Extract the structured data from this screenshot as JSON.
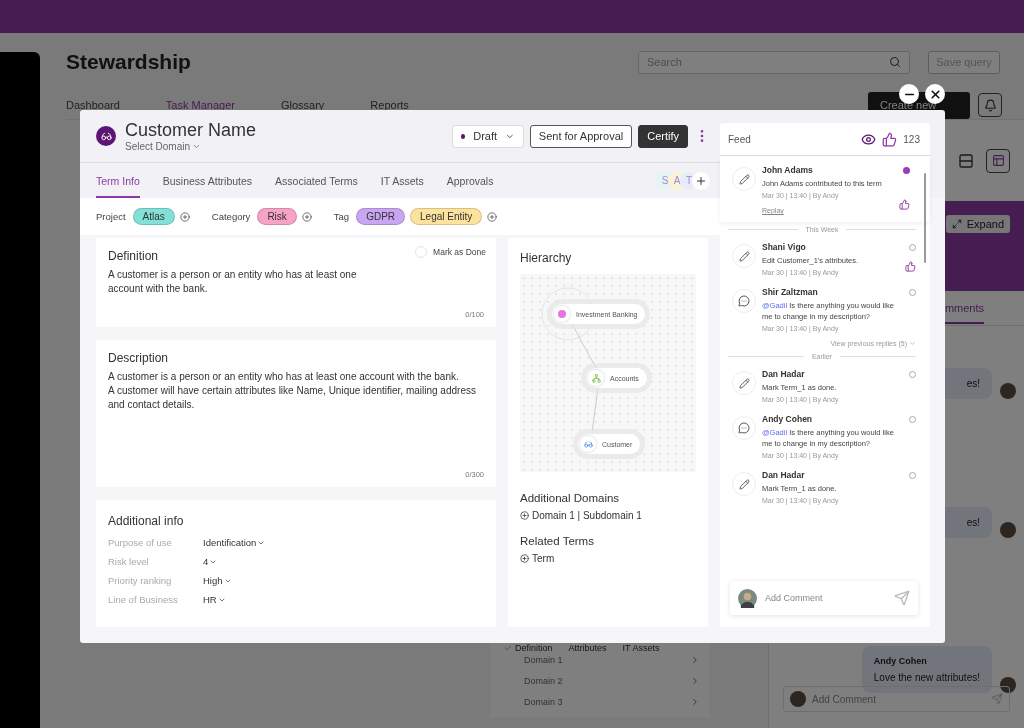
{
  "page": {
    "title": "Stewardship",
    "search": {
      "placeholder": "Search"
    },
    "save_query": "Save query",
    "tabs": [
      {
        "label": "Dashboard",
        "selected": false
      },
      {
        "label": "Task Manager",
        "selected": true
      },
      {
        "label": "Glossary",
        "selected": false
      },
      {
        "label": "Reports",
        "selected": false
      }
    ],
    "create_button": "Create new",
    "domain_panel": {
      "tabs": [
        {
          "label": "Definition",
          "done": true
        },
        {
          "label": "Attributes",
          "done": false
        },
        {
          "label": "IT Assets",
          "done": false
        }
      ],
      "rows": [
        "Domain 1",
        "Domain 2",
        "Domain 3"
      ]
    },
    "detail_panel": {
      "expand": "Expand",
      "tab": "mments",
      "messages": [
        {
          "text": "es!"
        },
        {
          "text": "es!"
        },
        {
          "author": "Andy Cohen",
          "text": "Love the new attributes!"
        }
      ],
      "comment": {
        "placeholder": "Add Comment"
      }
    }
  },
  "modal": {
    "title": "Customer Name",
    "domain": "Select Domain",
    "status": "Draft",
    "actions": [
      {
        "label": "Sent for Approval",
        "kind": "outline"
      },
      {
        "label": "Certify",
        "kind": "solid"
      }
    ],
    "tabs": [
      {
        "label": "Term Info",
        "selected": true
      },
      {
        "label": "Business Attributes",
        "selected": false
      },
      {
        "label": "Associated Terms",
        "selected": false
      },
      {
        "label": "IT Assets",
        "selected": false
      },
      {
        "label": "Approvals",
        "selected": false
      }
    ],
    "collaborators": [
      {
        "initial": "S",
        "color": "#e3f6f4"
      },
      {
        "initial": "A",
        "color": "#fbf3d6"
      },
      {
        "initial": "T",
        "color": "#e6ecfa"
      }
    ],
    "properties": [
      {
        "label": "Project",
        "tags": [
          {
            "text": "Atlas",
            "color": "#82e0d6"
          }
        ]
      },
      {
        "label": "Category",
        "tags": [
          {
            "text": "Risk",
            "color": "#f7a3c6"
          }
        ]
      },
      {
        "label": "Tag",
        "tags": [
          {
            "text": "GDPR",
            "color": "#c9a6f2"
          },
          {
            "text": "Legal Entity",
            "color": "#fce39d"
          }
        ]
      }
    ],
    "definition": {
      "title": "Definition",
      "text": "A customer is a person or an entity who has at least one account with the bank.",
      "counter": "0/100",
      "mark_done": {
        "label": "Mark as Done",
        "checked": false
      }
    },
    "description": {
      "title": "Description",
      "paragraphs": [
        "A customer is a person or an entity who has at least one account with the bank.",
        "A customer will have certain attributes like Name, Unique identifier, mailing address and contact details."
      ],
      "counter": "0/300"
    },
    "additional_info": {
      "title": "Additional info",
      "fields": [
        {
          "label": "Purpose of use",
          "value": "Identification"
        },
        {
          "label": "Risk level",
          "value": "4"
        },
        {
          "label": "Priority ranking",
          "value": "High"
        },
        {
          "label": "Line of Business",
          "value": "HR"
        }
      ]
    },
    "hierarchy": {
      "title": "Hierarchy",
      "nodes": [
        {
          "label": "Investment Banking",
          "kind": "domain"
        },
        {
          "label": "Accounts",
          "kind": "group"
        },
        {
          "label": "Customer",
          "kind": "term"
        }
      ]
    },
    "additional_domains": {
      "title": "Additional Domains",
      "items": [
        "Domain 1 | Subdomain 1"
      ]
    },
    "related_terms": {
      "title": "Related Terms",
      "items": [
        "Term"
      ]
    },
    "feed": {
      "title": "Feed",
      "likes": "123",
      "entries": [
        {
          "kind": "activity",
          "author": "John Adams",
          "text": "John Adams contributed to this term",
          "meta": "Mar 30 | 13:40 | By Andy",
          "unread": true,
          "liked": true,
          "reply": "Replay"
        },
        {
          "kind": "divider",
          "label": "This Week"
        },
        {
          "kind": "activity",
          "author": "Shani Vigo",
          "text": "Edit Customer_1's attributes.",
          "meta": "Mar 30 | 13:40 | By Andy",
          "unread": false,
          "liked": true
        },
        {
          "kind": "comment",
          "author": "Shir Zaltzman",
          "mention": "@Gadil",
          "text": "Is there anything you would like me to change in my description?",
          "meta": "Mar 30 | 13:40 | By Andy",
          "unread": false,
          "liked": false
        },
        {
          "kind": "more",
          "label": "View previous replies (5)"
        },
        {
          "kind": "divider",
          "label": "Earlier"
        },
        {
          "kind": "activity",
          "author": "Dan Hadar",
          "text": "Mark Term_1 as done.",
          "meta": "Mar 30 | 13:40 | By Andy",
          "unread": false,
          "liked": false
        },
        {
          "kind": "comment",
          "author": "Andy Cohen",
          "mention": "@Gadil",
          "text": "Is there anything you would like me to change in my description?",
          "meta": "Mar 30 | 13:40 | By Andy",
          "unread": false,
          "liked": false
        },
        {
          "kind": "activity",
          "author": "Dan Hadar",
          "text": "Mark Term_1 as done.",
          "meta": "Mar 30 | 13:40 | By Andy",
          "unread": false,
          "liked": false
        }
      ],
      "comment": {
        "placeholder": "Add Comment"
      }
    }
  }
}
